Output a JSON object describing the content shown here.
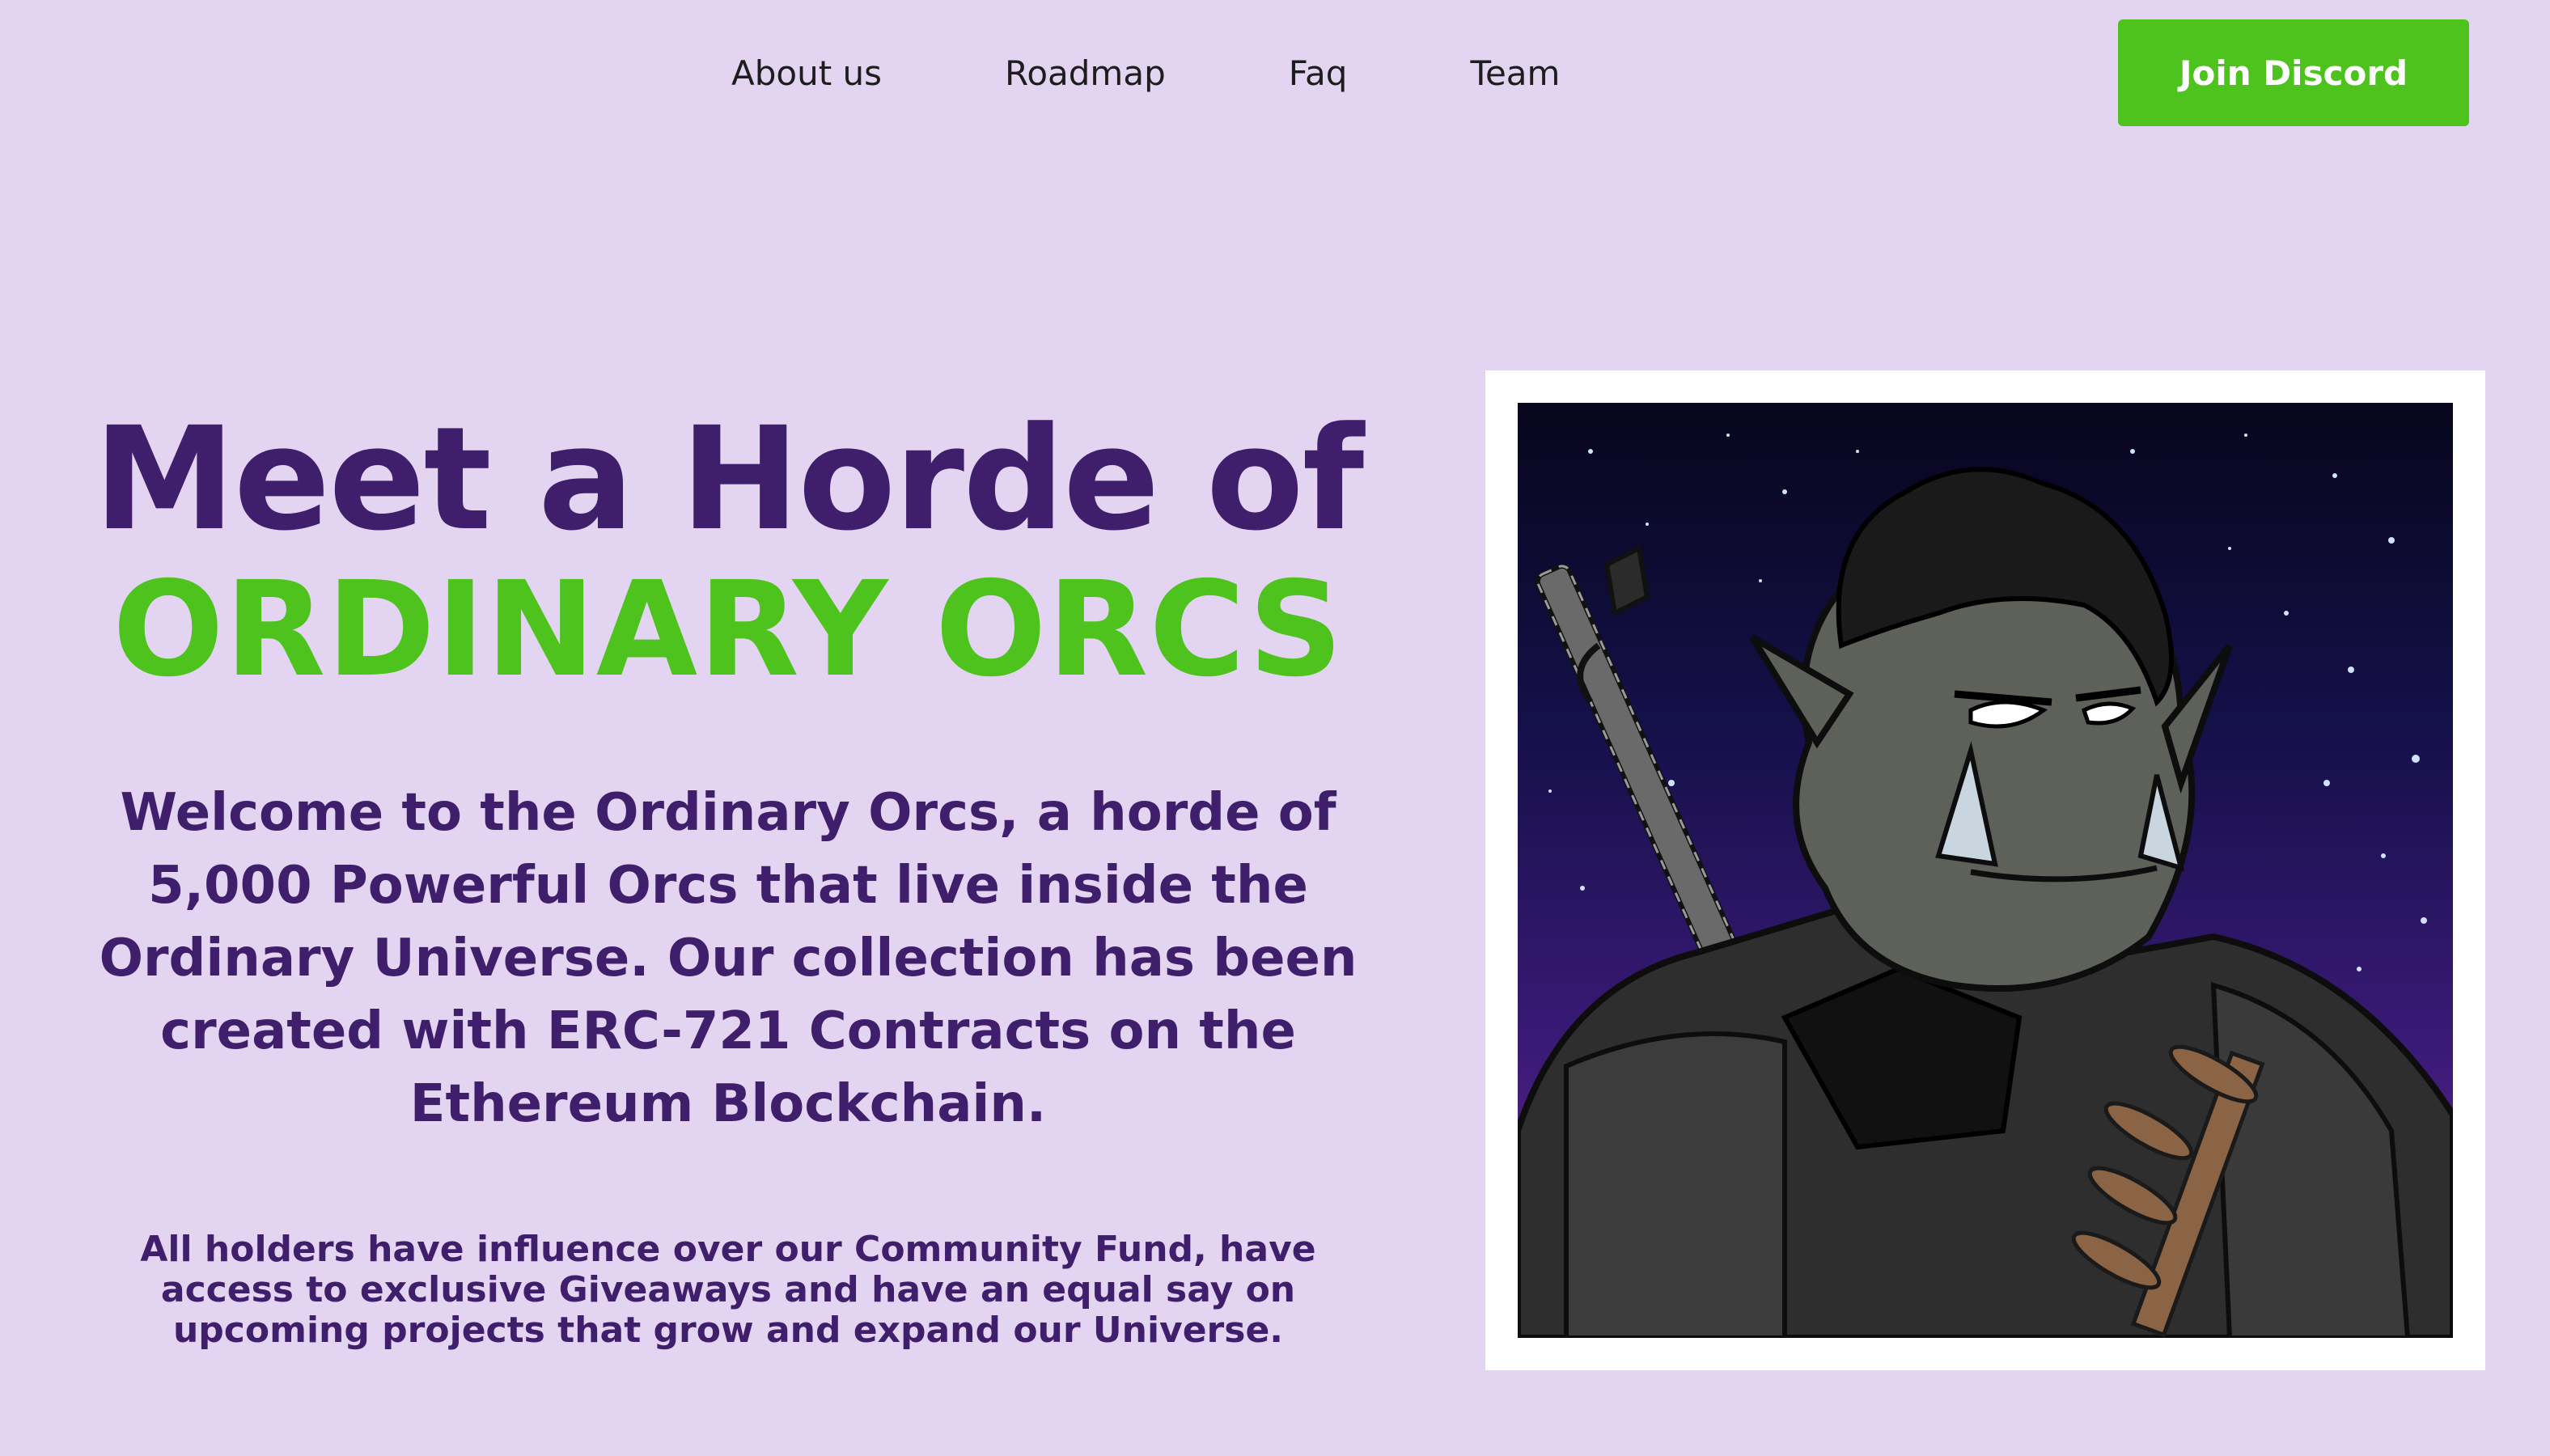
{
  "nav": {
    "links": [
      "About us",
      "Roadmap",
      "Faq",
      "Team"
    ],
    "cta_label": "Join Discord"
  },
  "hero": {
    "title_line1": "Meet a Horde of",
    "title_line2": "ORDINARY ORCS",
    "intro": "Welcome to the Ordinary Orcs, a horde of 5,000 Powerful Orcs that live inside the Ordinary Universe. Our collection has been created with ERC-721 Contracts on the Ethereum Blockchain.",
    "details": "All holders have influence over our Community Fund, have access to exclusive Giveaways and have an equal say on upcoming projects that grow and expand our Universe."
  },
  "colors": {
    "background": "#e3d5f2",
    "primary_purple": "#3f1f6c",
    "accent_green": "#4ec31e"
  }
}
